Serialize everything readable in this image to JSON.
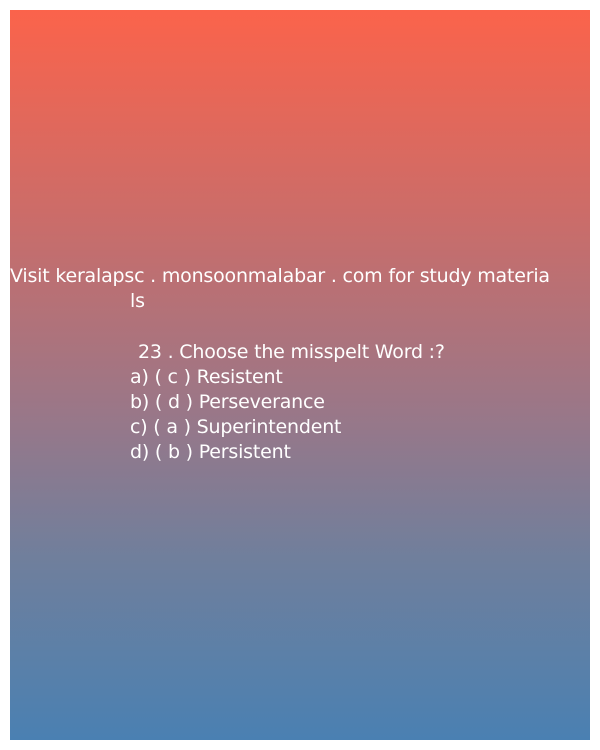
{
  "promo": {
    "line1": "Visit keralapsc . monsoonmalabar . com for study materia",
    "line2": "ls"
  },
  "question": {
    "text": "23 . Choose the misspelt Word :?"
  },
  "options": [
    {
      "text": "a) ( c ) Resistent"
    },
    {
      "text": "b) ( d ) Perseverance"
    },
    {
      "text": "c) ( a ) Superintendent"
    },
    {
      "text": "d) ( b ) Persistent"
    }
  ],
  "colors": {
    "gradient_top": "#fb634b",
    "gradient_bottom": "#4a80b2",
    "text": "#ffffff"
  }
}
